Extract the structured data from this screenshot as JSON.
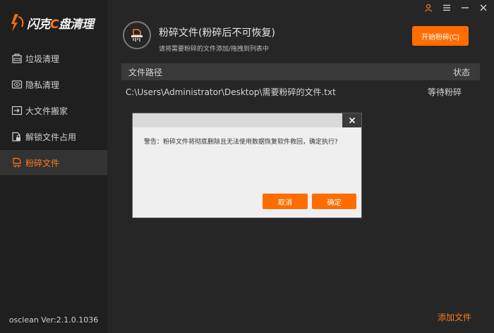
{
  "app": {
    "logo_text_a": "闪克",
    "logo_text_c": "C",
    "logo_text_b": "盘清理",
    "accent_color": "#ff6d00",
    "version": "osclean Ver:2.1.0.1036"
  },
  "topbar": {
    "icons": [
      "user-icon",
      "menu-icon",
      "minimize-icon",
      "close-icon"
    ]
  },
  "sidebar": {
    "items": [
      {
        "label": "垃圾清理",
        "icon": "trash-icon",
        "active": false
      },
      {
        "label": "隐私清理",
        "icon": "privacy-icon",
        "active": false
      },
      {
        "label": "大文件搬家",
        "icon": "move-file-icon",
        "active": false
      },
      {
        "label": "解锁文件占用",
        "icon": "unlock-file-icon",
        "active": false
      },
      {
        "label": "粉碎文件",
        "icon": "shred-icon",
        "active": true
      }
    ]
  },
  "header": {
    "title": "粉碎文件(粉碎后不可恢复)",
    "subtitle": "请将需要粉碎的文件添加/拖拽到列表中",
    "start_button": "开始粉碎(C)"
  },
  "table": {
    "columns": [
      "文件路径",
      "状态"
    ],
    "rows": [
      {
        "path": "C:\\Users\\Administrator\\Desktop\\需要粉碎的文件.txt",
        "status": "等待粉碎"
      }
    ]
  },
  "footer": {
    "add_file": "添加文件"
  },
  "dialog": {
    "message": "警告：粉碎文件将彻底删除且无法使用数据恢复软件救回，确定执行?",
    "cancel": "取消",
    "ok": "确定"
  }
}
